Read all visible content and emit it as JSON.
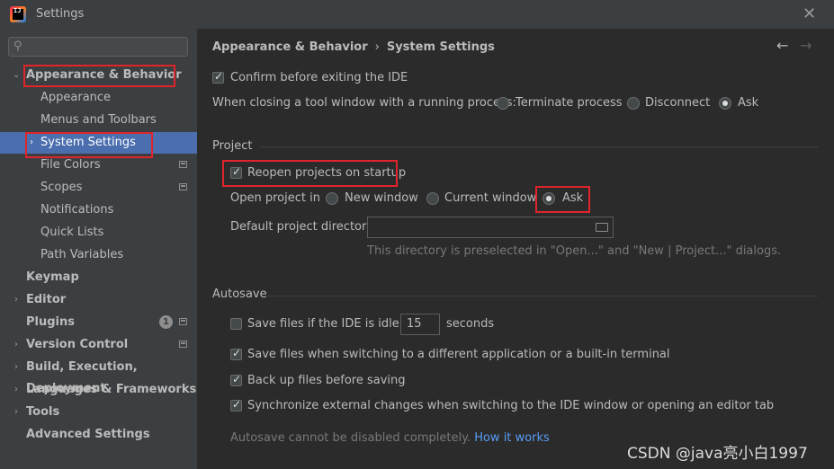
{
  "window": {
    "title": "Settings",
    "app_icon_text": "IJ"
  },
  "search": {
    "placeholder": ""
  },
  "sidebar": {
    "items": [
      {
        "label": "Appearance & Behavior"
      },
      {
        "label": "Appearance"
      },
      {
        "label": "Menus and Toolbars"
      },
      {
        "label": "System Settings"
      },
      {
        "label": "File Colors"
      },
      {
        "label": "Scopes"
      },
      {
        "label": "Notifications"
      },
      {
        "label": "Quick Lists"
      },
      {
        "label": "Path Variables"
      },
      {
        "label": "Keymap"
      },
      {
        "label": "Editor"
      },
      {
        "label": "Plugins",
        "badge": "1"
      },
      {
        "label": "Version Control"
      },
      {
        "label": "Build, Execution, Deployment"
      },
      {
        "label": "Languages & Frameworks"
      },
      {
        "label": "Tools"
      },
      {
        "label": "Advanced Settings"
      }
    ]
  },
  "breadcrumb": {
    "parent": "Appearance & Behavior",
    "separator": "›",
    "current": "System Settings"
  },
  "general": {
    "confirm_exit": "Confirm before exiting the IDE",
    "closing_label": "When closing a tool window with a running process:",
    "closing_options": [
      "Terminate process",
      "Disconnect",
      "Ask"
    ]
  },
  "project": {
    "title": "Project",
    "reopen": "Reopen projects on startup",
    "open_in_label": "Open project in",
    "open_options": [
      "New window",
      "Current window",
      "Ask"
    ],
    "dir_label": "Default project directory:",
    "dir_value": "",
    "dir_hint": "This directory is preselected in \"Open...\" and \"New | Project...\" dialogs."
  },
  "autosave": {
    "title": "Autosave",
    "idle_prefix": "Save files if the IDE is idle for",
    "idle_value": "15",
    "idle_suffix": "seconds",
    "switch_app": "Save files when switching to a different application or a built-in terminal",
    "backup": "Back up files before saving",
    "sync": "Synchronize external changes when switching to the IDE window or opening an editor tab",
    "note": "Autosave cannot be disabled completely.",
    "note_link": "How it works"
  },
  "watermark": "CSDN @java亮小白1997",
  "colors": {
    "selection": "#4b6eaf",
    "highlight": "#e0242c",
    "link": "#589df6"
  }
}
